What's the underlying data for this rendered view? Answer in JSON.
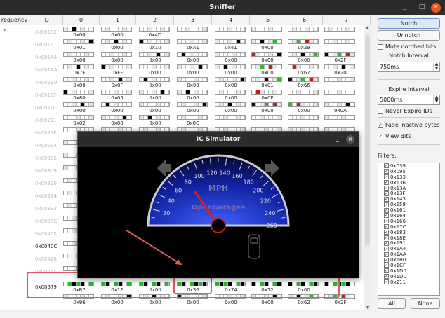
{
  "window": {
    "title": "Sniffer"
  },
  "table": {
    "headers": [
      "requency",
      "ID",
      "0",
      "1",
      "2",
      "3",
      "4",
      "5",
      "6",
      "7"
    ],
    "rows": [
      {
        "freq": "z",
        "id": "0x0018E",
        "vals": [
          "0x00",
          "0x00",
          "0x4D",
          "",
          "",
          "",
          "",
          ""
        ]
      },
      {
        "freq": "",
        "id": "0x00191",
        "vals": [
          "0x01",
          "0x00",
          "0x10",
          "0xA1",
          "0x41",
          "0x00",
          "0x29",
          ""
        ]
      },
      {
        "freq": "",
        "id": "0x001A4",
        "vals": [
          "0x00",
          "0x00",
          "0x00",
          "0x08",
          "0x00",
          "0x00",
          "0x00",
          "0x2F"
        ]
      },
      {
        "freq": "",
        "id": "0x001AA",
        "vals": [
          "0x7F",
          "0xFF",
          "0x00",
          "0x00",
          "0x00",
          "0x00",
          "0x67",
          "0x20"
        ]
      },
      {
        "freq": "",
        "id": "0x001B0",
        "vals": [
          "0x00",
          "0x0F",
          "0x00",
          "0x00",
          "0x00",
          "0x01",
          "0x66",
          ""
        ]
      },
      {
        "freq": "",
        "id": "0x001CF",
        "vals": [
          "0x80",
          "0x05",
          "0x00",
          "0x00",
          "0x00",
          "0x0F",
          "",
          ""
        ]
      },
      {
        "freq": "",
        "id": "0x001DC",
        "vals": [
          "0x00",
          "0x00",
          "0x00",
          "0x00",
          "0x00",
          "0x00",
          "0x00",
          "0x0A"
        ]
      },
      {
        "freq": "",
        "id": "0x00211",
        "vals": [
          "0x02",
          "0x00",
          "0x00",
          "0x0C",
          "",
          "",
          "",
          ""
        ]
      },
      {
        "freq": "",
        "id": "0x0021E",
        "vals": [
          "",
          "",
          "",
          "",
          "",
          "",
          "",
          ""
        ]
      },
      {
        "freq": "",
        "id": "0x00294",
        "vals": [
          "",
          "",
          "",
          "",
          "",
          "",
          "",
          ""
        ]
      },
      {
        "freq": "",
        "id": "0x00305",
        "vals": [
          "",
          "",
          "",
          "",
          "",
          "",
          "",
          ""
        ]
      },
      {
        "freq": "",
        "id": "0x00309",
        "vals": [
          "",
          "",
          "",
          "",
          "",
          "",
          "",
          ""
        ]
      },
      {
        "freq": "",
        "id": "0x00320",
        "vals": [
          "",
          "",
          "",
          "",
          "",
          "",
          "",
          ""
        ]
      },
      {
        "freq": "",
        "id": "0x00324",
        "vals": [
          "",
          "",
          "",
          "",
          "",
          "",
          "",
          ""
        ]
      },
      {
        "freq": "",
        "id": "0x00333",
        "vals": [
          "",
          "",
          "",
          "",
          "",
          "",
          "",
          ""
        ]
      },
      {
        "freq": "",
        "id": "0x0037C",
        "vals": [
          "",
          "",
          "",
          "",
          "",
          "",
          "",
          ""
        ]
      },
      {
        "freq": "",
        "id": "0x00405",
        "vals": [
          "",
          "",
          "",
          "",
          "",
          "",
          "",
          ""
        ]
      },
      {
        "freq": "",
        "id": "0x0040C",
        "vals": [
          "",
          "",
          "",
          "",
          "",
          "",
          "",
          ""
        ]
      },
      {
        "freq": "",
        "id": "0x00428",
        "vals": [
          "",
          "",
          "",
          "",
          "",
          "",
          "",
          ""
        ]
      },
      {
        "freq": "",
        "id": "0x0045C",
        "vals": [
          "",
          "",
          "",
          "",
          "",
          "",
          "",
          ""
        ]
      },
      {
        "freq": "",
        "id": "0x00579",
        "vals": [
          "0xB2",
          "0x12",
          "0x00",
          "0x36",
          "0x74",
          "0x72",
          "0x00",
          ""
        ]
      },
      {
        "freq": "",
        "id": "",
        "vals": [
          "0x96",
          "0x00",
          "0x00",
          "0x00",
          "0x00",
          "0x00",
          "0x62",
          "0x2F"
        ]
      }
    ]
  },
  "panel": {
    "notch": "Notch",
    "unnotch": "Unnotch",
    "mute": "Mute notched bits",
    "notch_interval_label": "Notch Interval",
    "notch_interval": "750ms",
    "expire_label": "Expire Interval",
    "expire": "5000ms",
    "never_expire": "Never Expire IDs",
    "fade": "Fade inactive bytes",
    "view_bits": "View Bits",
    "filters_label": "Filters:",
    "all": "All",
    "none": "None",
    "filters": [
      "0x039",
      "0x095",
      "0x133",
      "0x136",
      "0x13A",
      "0x13F",
      "0x143",
      "0x158",
      "0x161",
      "0x164",
      "0x166",
      "0x17C",
      "0x183",
      "0x18E",
      "0x191",
      "0x1A4",
      "0x1AA",
      "0x1B0",
      "0x1CF",
      "0x1D0",
      "0x1DC",
      "0x211"
    ]
  },
  "sim": {
    "title": "IC Simulator",
    "unit": "MPH",
    "brand": "OpenGarages",
    "gauge": {
      "min": 0,
      "max": 260,
      "labels": [
        "20",
        "40",
        "60",
        "80",
        "100",
        "120",
        "140",
        "160",
        "180",
        "200",
        "220",
        "240",
        "260"
      ],
      "needle_value": 80
    }
  },
  "colors": {
    "highlight": "#e05860",
    "green": "#22c022",
    "red": "#d01818",
    "black": "#000000"
  }
}
